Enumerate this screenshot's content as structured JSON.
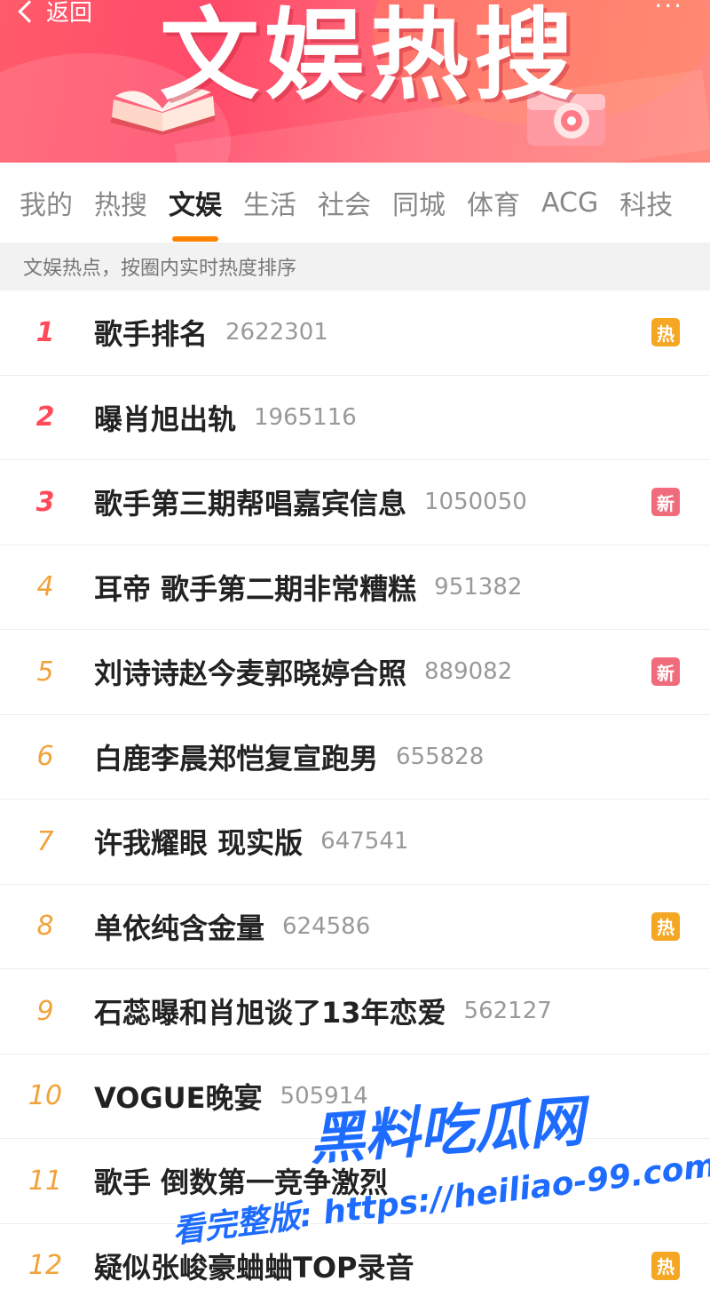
{
  "header": {
    "back_label": "返回",
    "more_label": "···",
    "banner_title": "文娱热搜"
  },
  "tabs": [
    {
      "label": "我的",
      "active": false
    },
    {
      "label": "热搜",
      "active": false
    },
    {
      "label": "文娱",
      "active": true
    },
    {
      "label": "生活",
      "active": false
    },
    {
      "label": "社会",
      "active": false
    },
    {
      "label": "同城",
      "active": false
    },
    {
      "label": "体育",
      "active": false
    },
    {
      "label": "ACG",
      "active": false
    },
    {
      "label": "科技",
      "active": false
    }
  ],
  "subheader": "文娱热点，按圈内实时热度排序",
  "hot_list": [
    {
      "rank": "1",
      "title": "歌手排名",
      "count": "2622301",
      "badge": "热",
      "badge_type": "hot"
    },
    {
      "rank": "2",
      "title": "曝肖旭出轨",
      "count": "1965116",
      "badge": "",
      "badge_type": ""
    },
    {
      "rank": "3",
      "title": "歌手第三期帮唱嘉宾信息",
      "count": "1050050",
      "badge": "新",
      "badge_type": "new"
    },
    {
      "rank": "4",
      "title": "耳帝 歌手第二期非常糟糕",
      "count": "951382",
      "badge": "",
      "badge_type": ""
    },
    {
      "rank": "5",
      "title": "刘诗诗赵今麦郭晓婷合照",
      "count": "889082",
      "badge": "新",
      "badge_type": "new"
    },
    {
      "rank": "6",
      "title": "白鹿李晨郑恺复宣跑男",
      "count": "655828",
      "badge": "",
      "badge_type": ""
    },
    {
      "rank": "7",
      "title": "许我耀眼 现实版",
      "count": "647541",
      "badge": "",
      "badge_type": ""
    },
    {
      "rank": "8",
      "title": "单依纯含金量",
      "count": "624586",
      "badge": "热",
      "badge_type": "hot"
    },
    {
      "rank": "9",
      "title": "石蕊曝和肖旭谈了13年恋爱",
      "count": "562127",
      "badge": "",
      "badge_type": ""
    },
    {
      "rank": "10",
      "title": "VOGUE晚宴",
      "count": "505914",
      "badge": "",
      "badge_type": ""
    },
    {
      "rank": "11",
      "title": "歌手 倒数第一竞争激烈",
      "count": "",
      "badge": "",
      "badge_type": ""
    },
    {
      "rank": "12",
      "title": "疑似张峻豪蛐蛐TOP录音",
      "count": "",
      "badge": "热",
      "badge_type": "hot"
    }
  ],
  "watermark": {
    "line1": "黑料吃瓜网",
    "line2": "看完整版: https://heiliao-99.com"
  },
  "colors": {
    "accent": "#ff8200",
    "rank_top": "#ff4a5a",
    "rank_rest": "#f2a23a",
    "badge_hot": "#f5a623",
    "badge_new": "#f06b7b"
  }
}
